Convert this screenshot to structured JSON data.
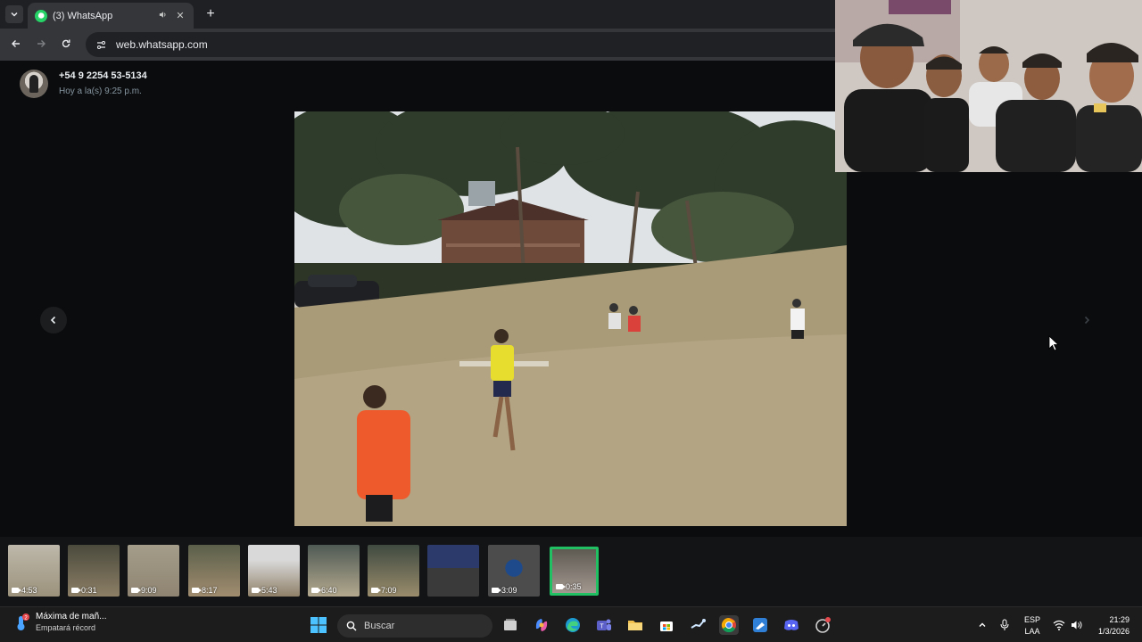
{
  "browser": {
    "tab_title": "(3) WhatsApp",
    "new_tab_symbol": "+",
    "url": "web.whatsapp.com"
  },
  "viewer": {
    "contact_name": "+54 9 2254 53-5134",
    "timestamp": "Hoy a la(s) 9:25 p.m."
  },
  "thumbnails": [
    {
      "duration": "4:53"
    },
    {
      "duration": "0:31"
    },
    {
      "duration": "9:09"
    },
    {
      "duration": "8:17"
    },
    {
      "duration": "5:43"
    },
    {
      "duration": "6:40"
    },
    {
      "duration": "7:09"
    },
    {
      "duration": ""
    },
    {
      "duration": "3:09"
    },
    {
      "duration": "0:35",
      "active": true
    }
  ],
  "taskbar": {
    "weather_title": "Máxima de mañ...",
    "weather_subtitle": "Empatará récord",
    "search_label": "Buscar",
    "language_line1": "ESP",
    "language_line2": "LAA",
    "time": "21:29",
    "date": "1/3/2026"
  },
  "colors": {
    "whatsapp_green": "#25d366",
    "active_thumb_border": "#21c063",
    "taskbar_bg": "#1c1c1c"
  }
}
